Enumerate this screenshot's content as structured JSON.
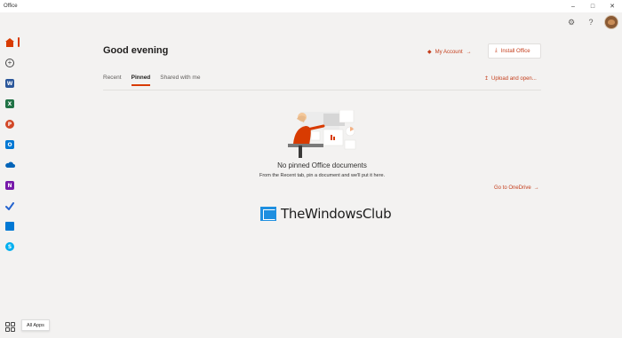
{
  "window": {
    "title": "Office",
    "controls": [
      "minimize",
      "maximize",
      "close"
    ]
  },
  "header": {
    "icons": [
      "settings-icon",
      "help-icon"
    ],
    "help_glyph": "?"
  },
  "rail": {
    "items": [
      {
        "name": "home",
        "active": true
      },
      {
        "name": "create"
      },
      {
        "name": "word",
        "letter": "W",
        "color": "#2b579a"
      },
      {
        "name": "excel",
        "letter": "X",
        "color": "#217346"
      },
      {
        "name": "powerpoint",
        "letter": "P",
        "color": "#d24726"
      },
      {
        "name": "outlook",
        "letter": "O",
        "color": "#0078d4"
      },
      {
        "name": "onedrive",
        "color": "#0364b8"
      },
      {
        "name": "onenote",
        "letter": "N",
        "color": "#7719aa"
      },
      {
        "name": "todo",
        "color": "#2564cf"
      },
      {
        "name": "teams-calendar",
        "color": "#0078d4"
      },
      {
        "name": "skype",
        "letter": "S",
        "color": "#00aff0"
      }
    ],
    "all_apps_tooltip": "All Apps"
  },
  "main": {
    "greeting": "Good evening",
    "my_account": "My Account",
    "install_office": "Install Office",
    "tabs": [
      "Recent",
      "Pinned",
      "Shared with me"
    ],
    "active_tab": "Pinned",
    "upload_open": "Upload and open...",
    "empty_title": "No pinned Office documents",
    "empty_subtitle": "From the Recent tab, pin a document and we'll put it here.",
    "go_to_onedrive": "Go to OneDrive"
  },
  "watermark": {
    "text": "TheWindowsClub"
  },
  "colors": {
    "accent": "#d83b01",
    "link": "#c43e1c"
  }
}
